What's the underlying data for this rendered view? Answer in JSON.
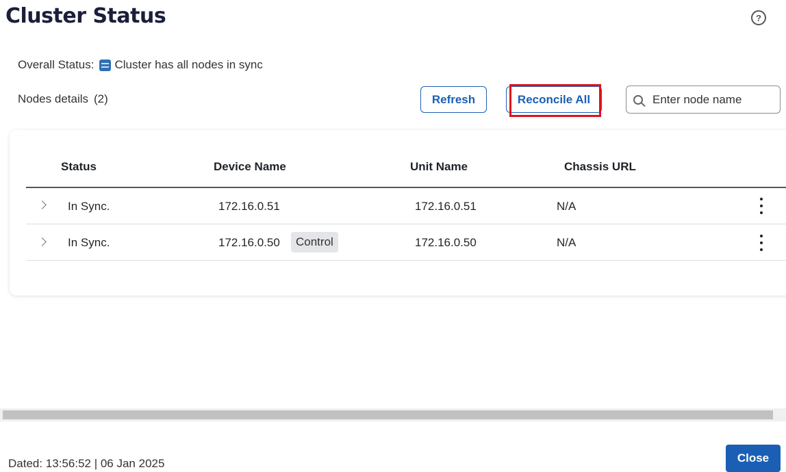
{
  "header": {
    "title": "Cluster Status",
    "help_icon": "help-circle-icon"
  },
  "overall": {
    "label": "Overall Status:",
    "icon": "cluster-sync-icon",
    "text": "Cluster has all nodes in sync"
  },
  "nodes": {
    "label": "Nodes details",
    "count": "(2)"
  },
  "toolbar": {
    "refresh_label": "Refresh",
    "reconcile_label": "Reconcile All",
    "search_placeholder": "Enter node name",
    "search_value": ""
  },
  "table": {
    "columns": [
      "Status",
      "Device Name",
      "Unit Name",
      "Chassis URL"
    ],
    "rows": [
      {
        "status": "In Sync.",
        "device": "172.16.0.51",
        "badge": "",
        "unit": "172.16.0.51",
        "chassis": "N/A"
      },
      {
        "status": "In Sync.",
        "device": "172.16.0.50",
        "badge": "Control",
        "unit": "172.16.0.50",
        "chassis": "N/A"
      }
    ]
  },
  "footer": {
    "dated": "Dated: 13:56:52 | 06 Jan 2025",
    "close_label": "Close"
  },
  "colors": {
    "accent": "#1a5fb4",
    "highlight": "#e0101a"
  }
}
